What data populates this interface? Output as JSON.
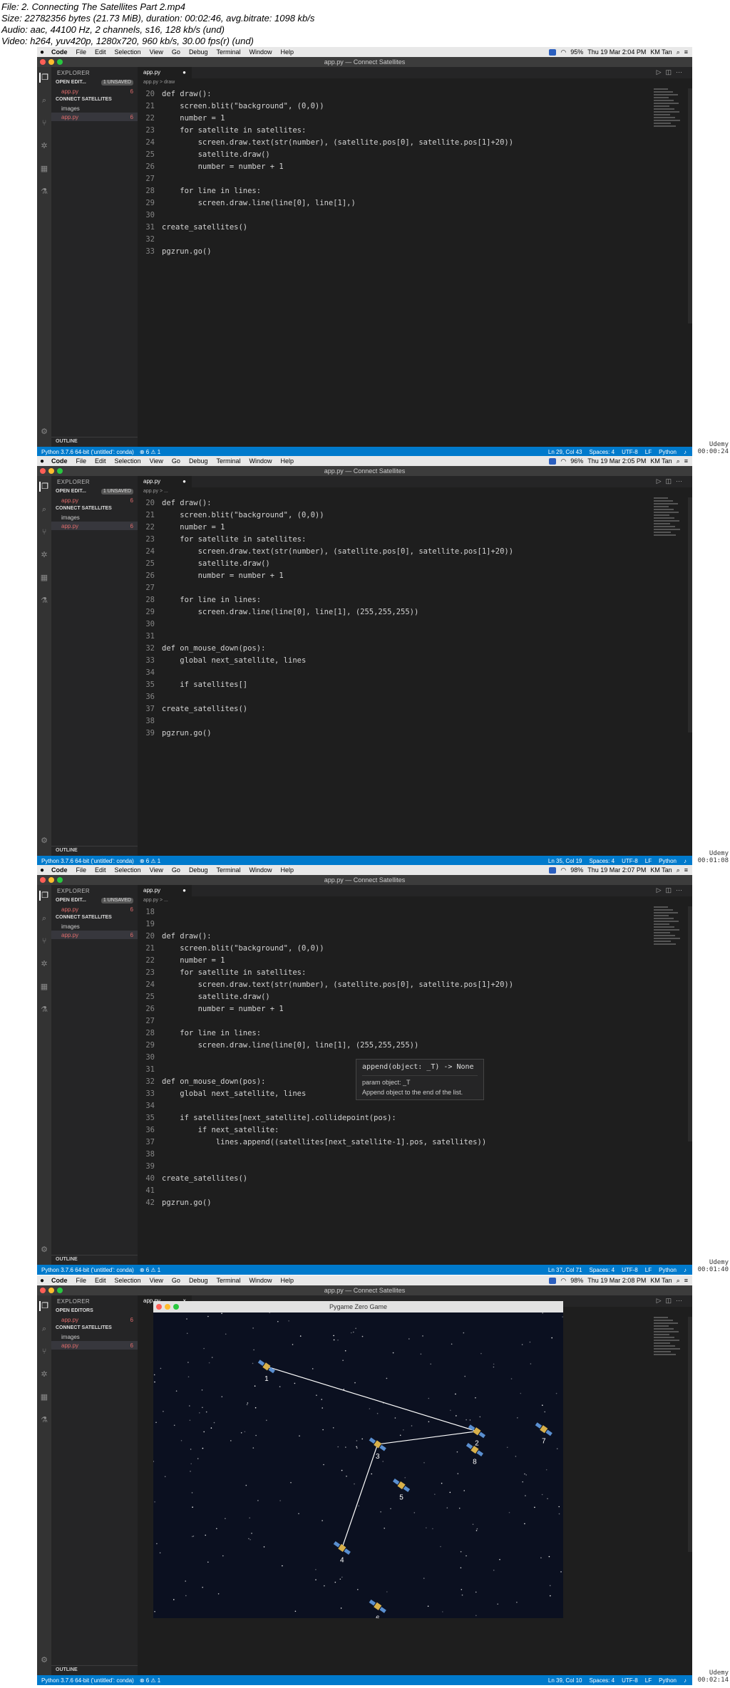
{
  "fileinfo": {
    "line1": "File: 2. Connecting The Satellites Part 2.mp4",
    "line2": "Size: 22782356 bytes (21.73 MiB), duration: 00:02:46, avg.bitrate: 1098 kb/s",
    "line3": "Audio: aac, 44100 Hz, 2 channels, s16, 128 kb/s (und)",
    "line4": "Video: h264, yuv420p, 1280x720, 960 kb/s, 30.00 fps(r) (und)"
  },
  "mac_menu": {
    "apple": "",
    "app": "Code",
    "items": [
      "File",
      "Edit",
      "Selection",
      "View",
      "Go",
      "Debug",
      "Terminal",
      "Window",
      "Help"
    ],
    "user": "KM Tan"
  },
  "window_title": "app.py — Connect Satellites",
  "explorer": {
    "header": "EXPLORER",
    "open_editors": "OPEN EDIT...",
    "unsaved": "1 UNSAVED",
    "open_editors_full": "OPEN EDITORS",
    "file": "app.py",
    "file_count": "6",
    "project": "CONNECT SATELLITES",
    "folder": "images",
    "outline": "OUTLINE"
  },
  "tab": {
    "label": "app.py",
    "dot": "●",
    "close": "×"
  },
  "breadcrumb": {
    "f1": "app.py > draw",
    "f2": "app.py > ...",
    "f3": "app.py > ..."
  },
  "frames": [
    {
      "time_label": "Udemy",
      "timestamp": "00:00:24",
      "clock": "Thu 19 Mar  2:04 PM",
      "battery": "95%",
      "status_left": "Python 3.7.6 64-bit ('untitled': conda)",
      "status_problems": "⊗ 6 ⚠ 1",
      "status_pos": "Ln 29, Col 43",
      "lines": [
        {
          "n": "20",
          "t": "def draw():"
        },
        {
          "n": "21",
          "t": "    screen.blit(\"background\", (0,0))"
        },
        {
          "n": "22",
          "t": "    number = 1"
        },
        {
          "n": "23",
          "t": "    for satellite in satellites:"
        },
        {
          "n": "24",
          "t": "        screen.draw.text(str(number), (satellite.pos[0], satellite.pos[1]+20))"
        },
        {
          "n": "25",
          "t": "        satellite.draw()"
        },
        {
          "n": "26",
          "t": "        number = number + 1"
        },
        {
          "n": "27",
          "t": ""
        },
        {
          "n": "28",
          "t": "    for line in lines:"
        },
        {
          "n": "29",
          "t": "        screen.draw.line(line[0], line[1],)"
        },
        {
          "n": "30",
          "t": ""
        },
        {
          "n": "31",
          "t": "create_satellites()"
        },
        {
          "n": "32",
          "t": ""
        },
        {
          "n": "33",
          "t": "pgzrun.go()"
        }
      ]
    },
    {
      "time_label": "Udemy",
      "timestamp": "00:01:08",
      "clock": "Thu 19 Mar  2:05 PM",
      "battery": "96%",
      "status_left": "Python 3.7.6 64-bit ('untitled': conda)",
      "status_problems": "⊗ 6 ⚠ 1",
      "status_pos": "Ln 35, Col 19",
      "lines": [
        {
          "n": "20",
          "t": "def draw():"
        },
        {
          "n": "21",
          "t": "    screen.blit(\"background\", (0,0))"
        },
        {
          "n": "22",
          "t": "    number = 1"
        },
        {
          "n": "23",
          "t": "    for satellite in satellites:"
        },
        {
          "n": "24",
          "t": "        screen.draw.text(str(number), (satellite.pos[0], satellite.pos[1]+20))"
        },
        {
          "n": "25",
          "t": "        satellite.draw()"
        },
        {
          "n": "26",
          "t": "        number = number + 1"
        },
        {
          "n": "27",
          "t": ""
        },
        {
          "n": "28",
          "t": "    for line in lines:"
        },
        {
          "n": "29",
          "t": "        screen.draw.line(line[0], line[1], (255,255,255))"
        },
        {
          "n": "30",
          "t": ""
        },
        {
          "n": "31",
          "t": ""
        },
        {
          "n": "32",
          "t": "def on_mouse_down(pos):"
        },
        {
          "n": "33",
          "t": "    global next_satellite, lines"
        },
        {
          "n": "34",
          "t": ""
        },
        {
          "n": "35",
          "t": "    if satellites[]"
        },
        {
          "n": "36",
          "t": ""
        },
        {
          "n": "37",
          "t": "create_satellites()"
        },
        {
          "n": "38",
          "t": ""
        },
        {
          "n": "39",
          "t": "pgzrun.go()"
        }
      ]
    },
    {
      "time_label": "Udemy",
      "timestamp": "00:01:40",
      "clock": "Thu 19 Mar  2:07 PM",
      "battery": "98%",
      "status_left": "Python 3.7.6 64-bit ('untitled': conda)",
      "status_problems": "⊗ 6 ⚠ 1",
      "status_pos": "Ln 37, Col 71",
      "lines": [
        {
          "n": "18",
          "t": ""
        },
        {
          "n": "19",
          "t": ""
        },
        {
          "n": "20",
          "t": "def draw():"
        },
        {
          "n": "21",
          "t": "    screen.blit(\"background\", (0,0))"
        },
        {
          "n": "22",
          "t": "    number = 1"
        },
        {
          "n": "23",
          "t": "    for satellite in satellites:"
        },
        {
          "n": "24",
          "t": "        screen.draw.text(str(number), (satellite.pos[0], satellite.pos[1]+20))"
        },
        {
          "n": "25",
          "t": "        satellite.draw()"
        },
        {
          "n": "26",
          "t": "        number = number + 1"
        },
        {
          "n": "27",
          "t": ""
        },
        {
          "n": "28",
          "t": "    for line in lines:"
        },
        {
          "n": "29",
          "t": "        screen.draw.line(line[0], line[1], (255,255,255))"
        },
        {
          "n": "30",
          "t": ""
        },
        {
          "n": "31",
          "t": ""
        },
        {
          "n": "32",
          "t": "def on_mouse_down(pos):"
        },
        {
          "n": "33",
          "t": "    global next_satellite, lines"
        },
        {
          "n": "34",
          "t": ""
        },
        {
          "n": "35",
          "t": "    if satellites[next_satellite].collidepoint(pos):"
        },
        {
          "n": "36",
          "t": "        if next_satellite:"
        },
        {
          "n": "37",
          "t": "            lines.append((satellites[next_satellite-1].pos, satellites))"
        },
        {
          "n": "38",
          "t": ""
        },
        {
          "n": "39",
          "t": ""
        },
        {
          "n": "40",
          "t": "create_satellites()"
        },
        {
          "n": "41",
          "t": ""
        },
        {
          "n": "42",
          "t": "pgzrun.go()"
        }
      ],
      "hover": {
        "sig": "append(object: _T) -> None",
        "param": "param object: _T",
        "doc": "Append object to the end of the list."
      }
    },
    {
      "time_label": "Udemy",
      "timestamp": "00:02:14",
      "clock": "Thu 19 Mar  2:08 PM",
      "battery": "98%",
      "status_left": "Python 3.7.6 64-bit ('untitled': conda)",
      "status_problems": "⊗ 6 ⚠ 1",
      "status_pos": "Ln 39, Col 10",
      "game_title": "Pygame Zero Game",
      "peek_text": "))",
      "satellites": [
        "1",
        "2",
        "3",
        "4",
        "5",
        "6",
        "7",
        "8"
      ]
    }
  ],
  "status_common": {
    "spaces": "Spaces: 4",
    "enc": "UTF-8",
    "eol": "LF",
    "lang": "Python"
  }
}
